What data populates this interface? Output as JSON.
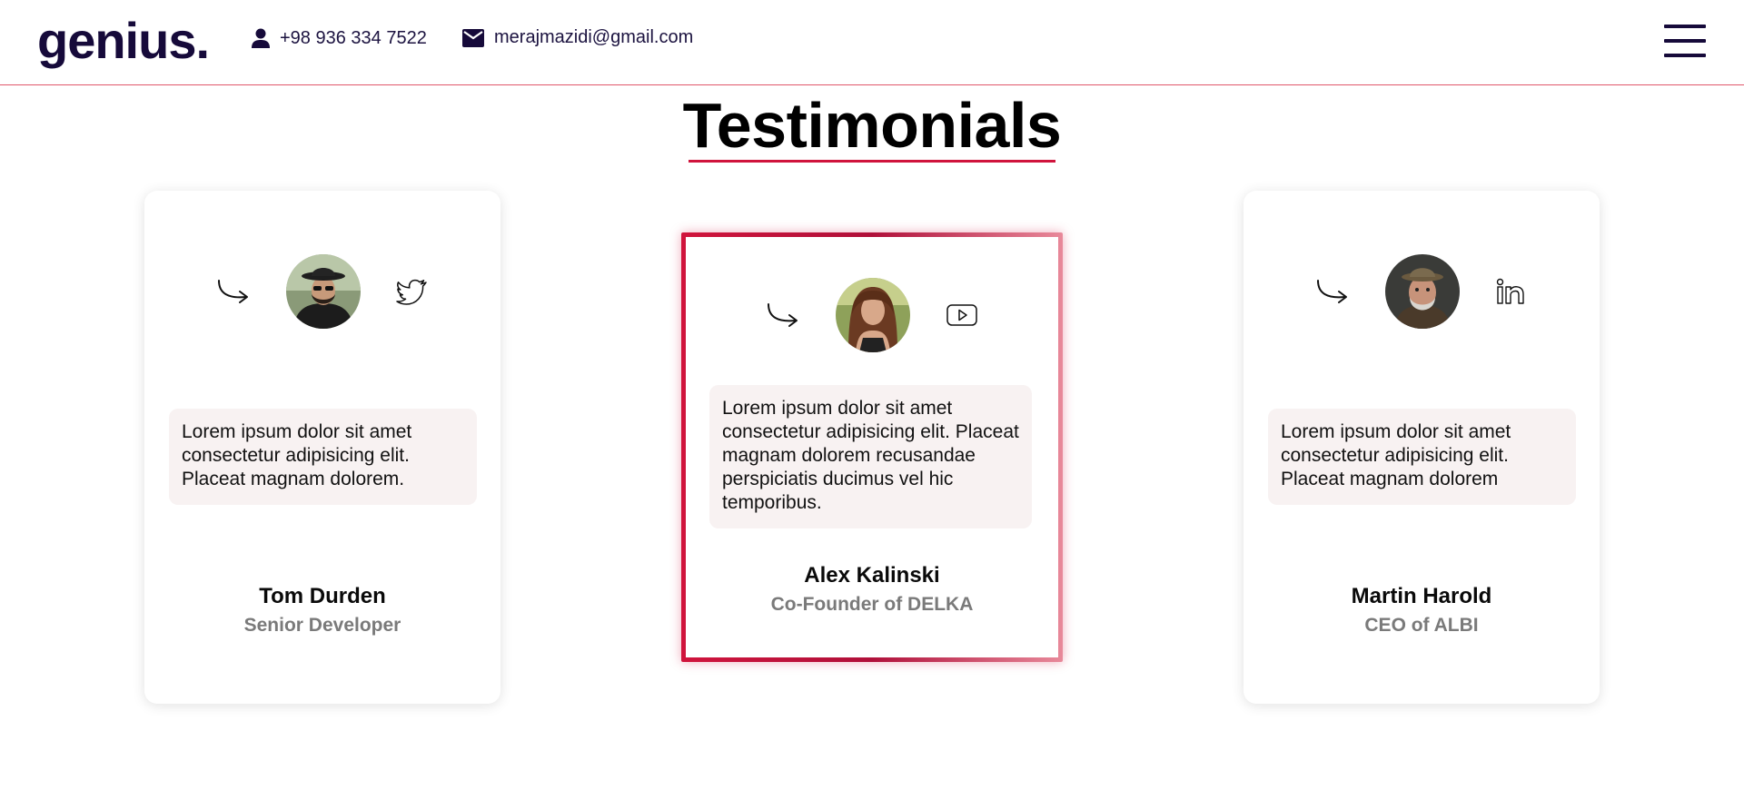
{
  "header": {
    "logo": "genius.",
    "phone": "+98 936 334 7522",
    "email": "merajmazidi@gmail.com",
    "icons": {
      "phone": "person-icon",
      "email": "envelope-icon",
      "menu": "hamburger-menu-icon"
    }
  },
  "section": {
    "title": "Testimonials",
    "accent_color": "#d0143c"
  },
  "testimonials": [
    {
      "name": "Tom Durden",
      "role": "Senior Developer",
      "quote": "Lorem ipsum dolor sit amet consectetur adipisicing elit. Placeat magnam dolorem.",
      "social_icon": "twitter-icon"
    },
    {
      "name": "Alex Kalinski",
      "role": "Co-Founder of DELKA",
      "quote": "Lorem ipsum dolor sit amet consectetur adipisicing elit. Placeat magnam dolorem recusandae perspiciatis ducimus vel hic temporibus.",
      "social_icon": "youtube-icon",
      "highlighted": true
    },
    {
      "name": "Martin Harold",
      "role": "CEO of ALBI",
      "quote": "Lorem ipsum dolor sit amet consectetur adipisicing elit. Placeat magnam dolorem",
      "social_icon": "linkedin-icon"
    }
  ]
}
